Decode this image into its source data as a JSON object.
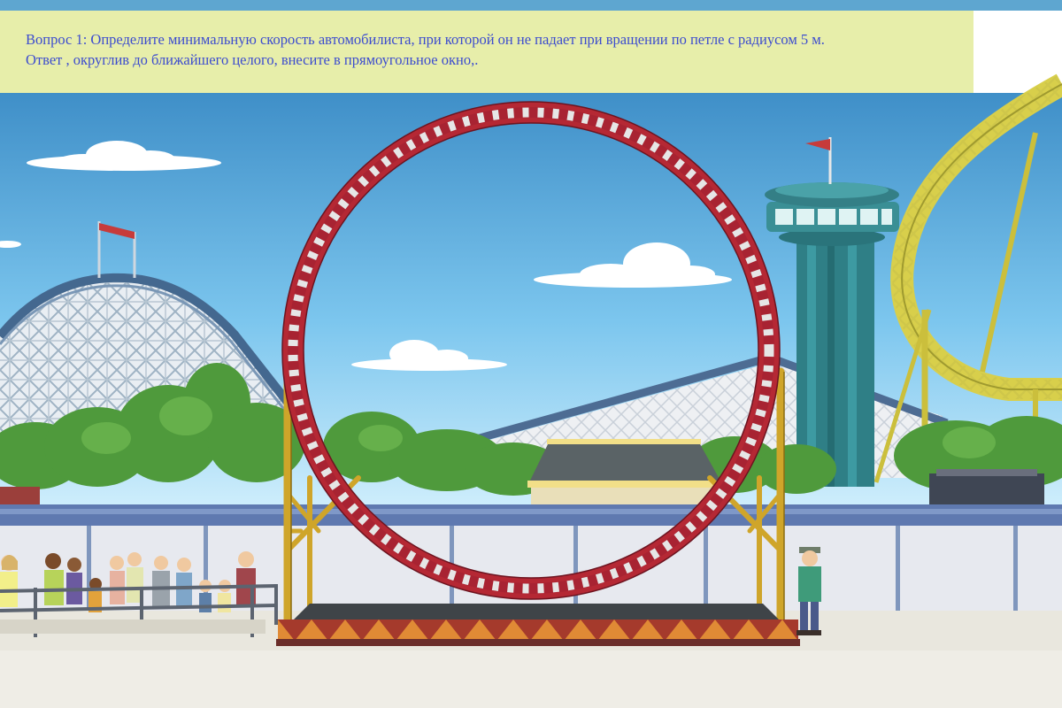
{
  "question": {
    "line1": "Вопрос 1: Определите минимальную скорость автомобилиста, при которой он не падает при вращении по петле с радиусом 5 м.",
    "line2": "Ответ , округлив до ближайшего целого, внесите в прямоугольное окно,."
  },
  "colors": {
    "panel_background": "#e7eeaa",
    "question_text": "#3c4ccf",
    "sky": "#5fb4e0",
    "loop_track": "#b52834",
    "support_frame": "#d1a626",
    "tower": "#2f7f86",
    "right_coaster": "#d9d24a",
    "trees": "#4f9a3c"
  },
  "scene": {
    "loop_radius_label": "5 м",
    "crowd_size": 16,
    "icons": [
      "flag-icon",
      "cloud-icon"
    ]
  }
}
